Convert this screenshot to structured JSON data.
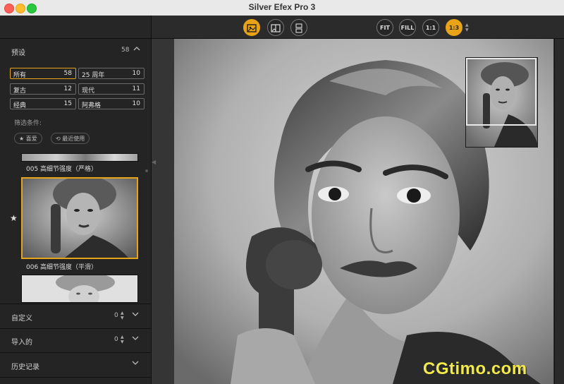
{
  "window": {
    "title": "Silver Efex Pro 3"
  },
  "toolbar": {
    "view_buttons": [
      {
        "icon": "single-image-icon",
        "active": true
      },
      {
        "icon": "split-view-icon",
        "active": false
      },
      {
        "icon": "side-by-side-icon",
        "active": false
      }
    ],
    "zoom_buttons": [
      "FIT",
      "FILL",
      "1:1",
      "1:3"
    ],
    "zoom_selected": "1:3"
  },
  "sidebar": {
    "presets": {
      "label": "预设",
      "count": "58",
      "categories": [
        {
          "name": "所有",
          "count": "58"
        },
        {
          "name": "25 周年",
          "count": "10"
        },
        {
          "name": "复古",
          "count": "12"
        },
        {
          "name": "现代",
          "count": "11"
        },
        {
          "name": "经典",
          "count": "15"
        },
        {
          "name": "阿弗格",
          "count": "10"
        }
      ],
      "filter_label": "筛选条件:",
      "filters": [
        "★ 喜爱",
        "⟲ 最近使用"
      ],
      "items": [
        {
          "caption": "005 高细节强度（严格）"
        },
        {
          "caption": "006 高细节强度（平滑）"
        }
      ]
    },
    "sections": [
      {
        "label": "自定义",
        "count": "0"
      },
      {
        "label": "导入的",
        "count": "0"
      },
      {
        "label": "历史记录",
        "count": ""
      }
    ]
  },
  "colors": {
    "accent": "#e8a317",
    "panel": "#242424",
    "canvas": "#353535"
  },
  "watermark": "CGtimo.com"
}
